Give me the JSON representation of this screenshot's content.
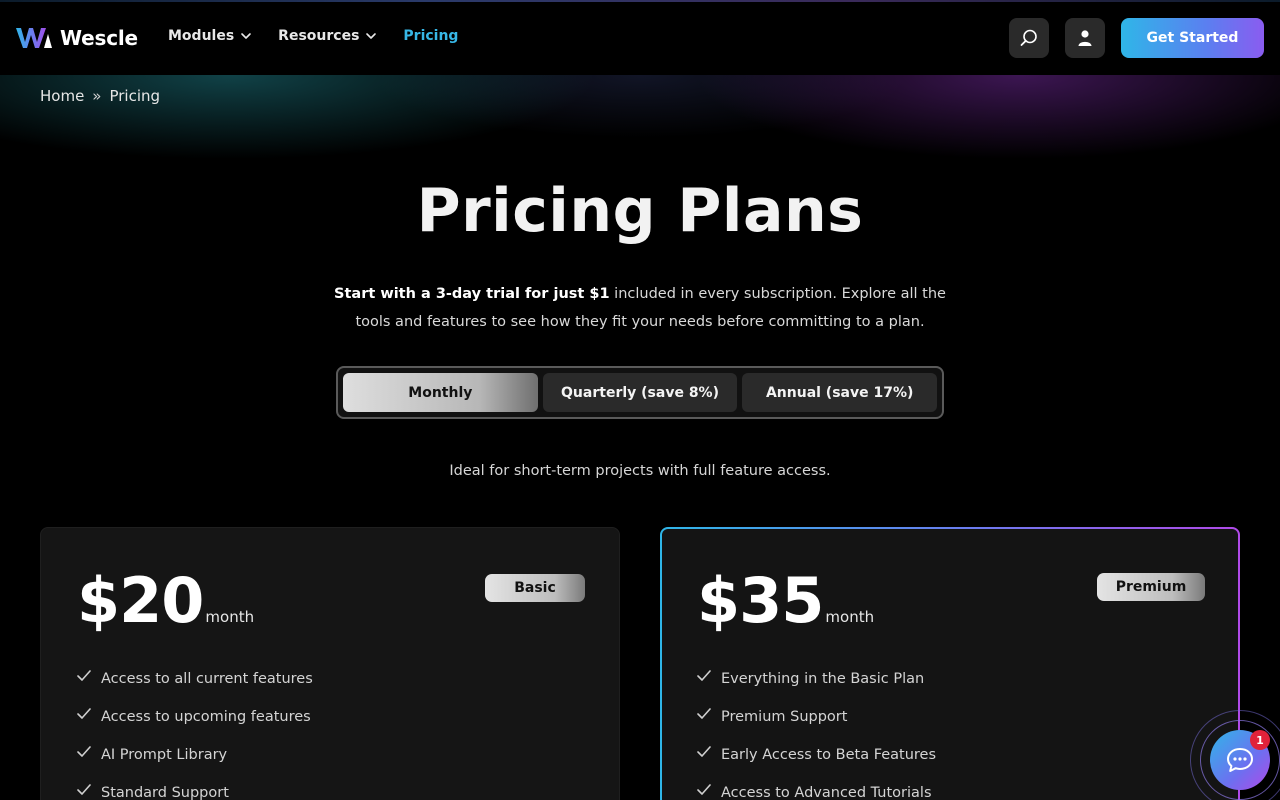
{
  "header": {
    "brand": "Wescle",
    "nav": [
      {
        "label": "Modules",
        "has_dropdown": true,
        "active": false
      },
      {
        "label": "Resources",
        "has_dropdown": true,
        "active": false
      },
      {
        "label": "Pricing",
        "has_dropdown": false,
        "active": true
      }
    ],
    "search_icon": "search-icon",
    "account_icon": "user-icon",
    "cta_label": "Get Started",
    "accent_color": "#37b7e6"
  },
  "breadcrumb": {
    "items": [
      "Home",
      "Pricing"
    ],
    "separator": "»"
  },
  "hero": {
    "title": "Pricing Plans",
    "subtitle_bold": "Start with a 3-day trial for just $1",
    "subtitle_rest": " included in every subscription. Explore all the tools and features to see how they fit your needs before committing to a plan."
  },
  "billing_toggle": {
    "options": [
      "Monthly",
      "Quarterly (save 8%)",
      "Annual (save 17%)"
    ],
    "selected": "Monthly"
  },
  "plan_description": "Ideal for short-term projects with full feature access.",
  "plans": [
    {
      "price": "$20",
      "unit": "month",
      "badge": "Basic",
      "features": [
        "Access to all current features",
        "Access to upcoming features",
        "AI Prompt Library",
        "Standard Support"
      ]
    },
    {
      "price": "$35",
      "unit": "month",
      "badge": "Premium",
      "features": [
        "Everything in the Basic Plan",
        "Premium Support",
        "Early Access to Beta Features",
        "Access to Advanced Tutorials"
      ]
    }
  ],
  "chat_widget": {
    "icon": "chat-bubble-icon",
    "notification_count": "1",
    "badge_color": "#e0223a"
  }
}
